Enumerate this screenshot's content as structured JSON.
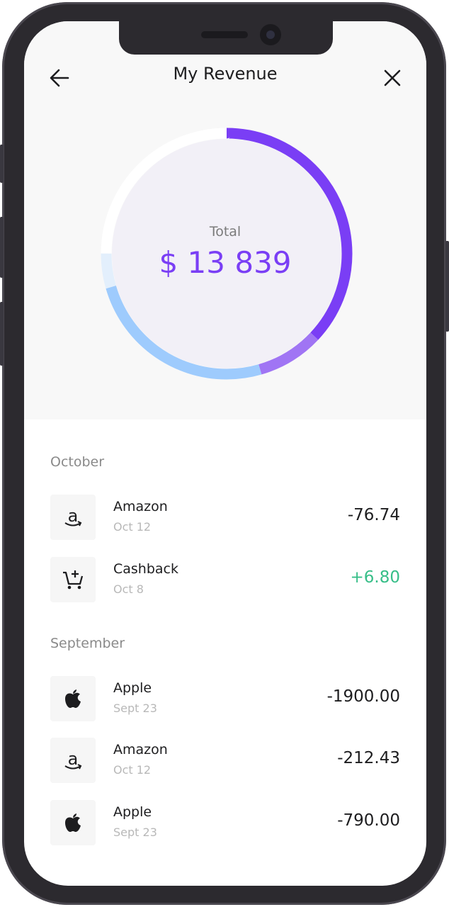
{
  "header": {
    "title": "My Revenue"
  },
  "summary": {
    "label": "Total",
    "value": "$ 13 839"
  },
  "ring": {
    "segments": [
      {
        "name": "purple-dark",
        "fraction": 0.37,
        "color": "#7a3ef5"
      },
      {
        "name": "purple-light",
        "fraction": 0.085,
        "color": "#a075f4"
      },
      {
        "name": "blue",
        "fraction": 0.25,
        "color": "#9ecbfd"
      },
      {
        "name": "blue-light",
        "fraction": 0.045,
        "color": "#e3effc"
      },
      {
        "name": "white",
        "fraction": 0.25,
        "color": "#ffffff"
      }
    ]
  },
  "sections": [
    {
      "label": "October",
      "items": [
        {
          "name": "Amazon",
          "date": "Oct 12",
          "amount": "-76.74",
          "icon": "amazon-icon"
        },
        {
          "name": "Cashback",
          "date": "Oct 8",
          "amount": "+6.80",
          "icon": "cart-plus-icon"
        }
      ]
    },
    {
      "label": "September",
      "items": [
        {
          "name": "Apple",
          "date": "Sept 23",
          "amount": "-1900.00",
          "icon": "apple-icon"
        },
        {
          "name": "Amazon",
          "date": "Oct 12",
          "amount": "-212.43",
          "icon": "amazon-icon"
        },
        {
          "name": "Apple",
          "date": "Sept 23",
          "amount": "-790.00",
          "icon": "apple-icon"
        }
      ]
    }
  ],
  "colors": {
    "accent": "#7a3ef5",
    "positive": "#37be88"
  }
}
